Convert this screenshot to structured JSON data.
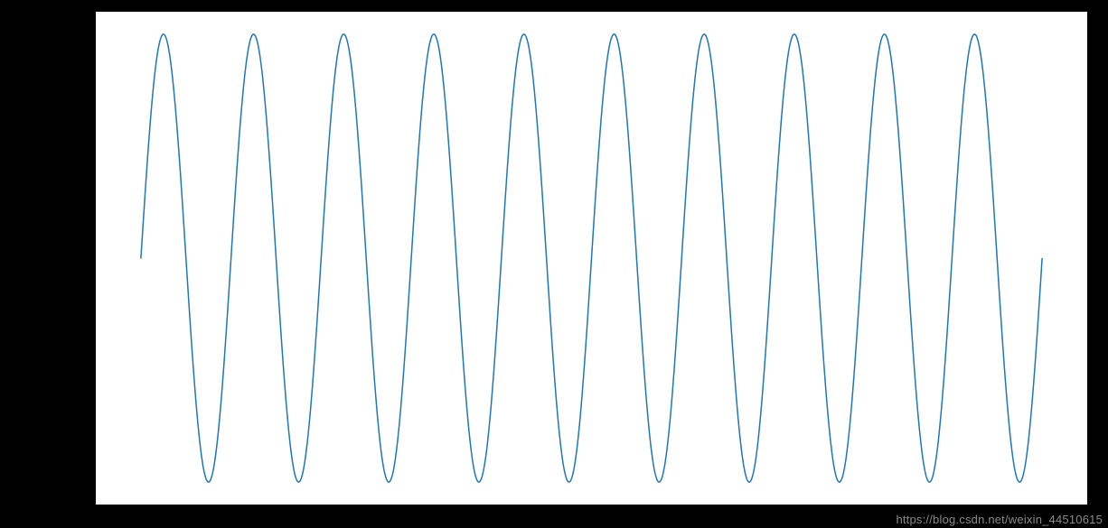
{
  "watermark_text": "https://blog.csdn.net/weixin_44510615",
  "chart_data": {
    "type": "line",
    "function": "sin",
    "cycles": 10,
    "x_range": [
      0,
      62.83
    ],
    "y_range": [
      -1,
      1
    ],
    "n_points": 1000,
    "series": [
      {
        "name": "sin(x)",
        "color": "#1f77b4"
      }
    ],
    "title": "",
    "xlabel": "",
    "ylabel": "",
    "xlim": [
      0,
      62.83
    ],
    "ylim": [
      -1.05,
      1.05
    ],
    "grid": false,
    "legend": false,
    "axes_visible": false
  }
}
